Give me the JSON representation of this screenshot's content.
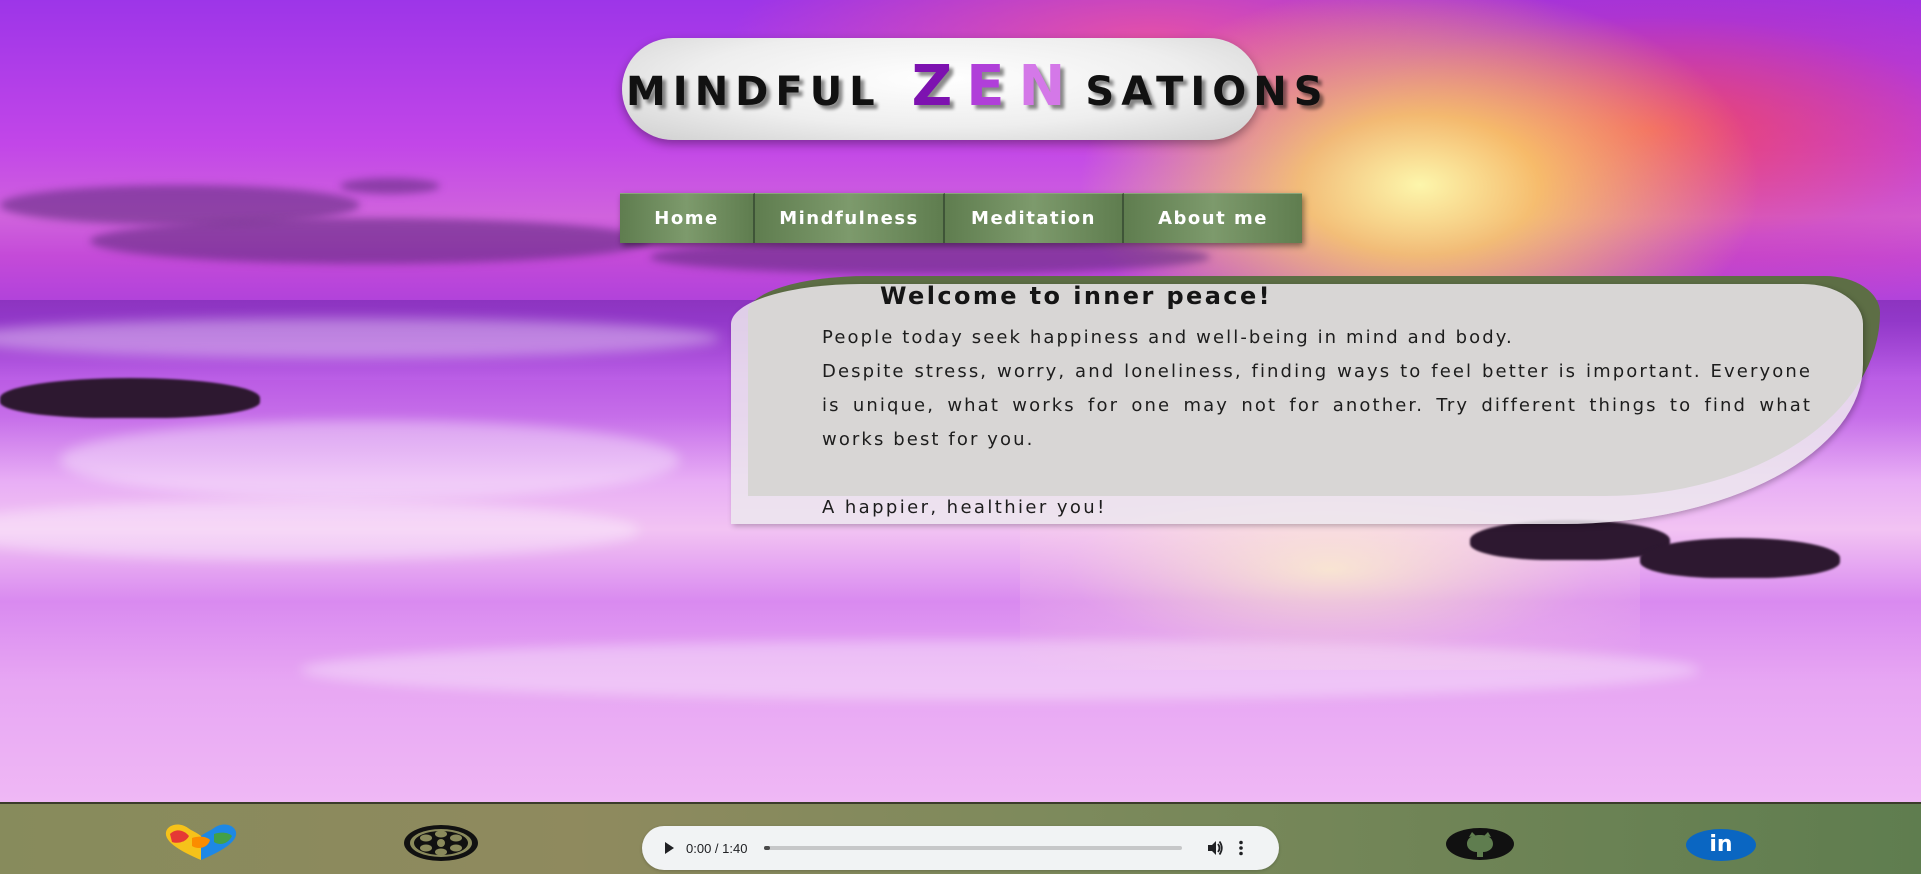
{
  "header": {
    "title_prefix": "MINDFUL",
    "title_highlight_letters": [
      "Z",
      "E",
      "N"
    ],
    "title_suffix": "SATIONS"
  },
  "nav": {
    "items": [
      {
        "label": "Home"
      },
      {
        "label": "Mindfulness"
      },
      {
        "label": "Meditation"
      },
      {
        "label": "About me"
      }
    ]
  },
  "welcome": {
    "heading": "Welcome to inner peace!",
    "paragraphs": [
      "People today seek happiness and well-being in mind and body.",
      "Despite stress, worry, and loneliness, finding ways to feel better is important. Everyone is unique, what works for one may not for another. Try different things to find what works best for you."
    ],
    "closing": "A happier, healthier you!"
  },
  "footer": {
    "icons": [
      "puzzle-heart-icon",
      "film-reel-icon",
      "github-icon",
      "linkedin-icon"
    ],
    "linkedin_text": "in",
    "audio": {
      "time": "0:00 / 1:40",
      "progress": 0.015
    }
  },
  "colors": {
    "nav_green": "#6f8c5e",
    "zen_purple_dark": "#7d12b0",
    "zen_purple_mid": "#b03fd9",
    "zen_purple_light": "#d478e8",
    "linkedin_blue": "#0a66c2"
  }
}
